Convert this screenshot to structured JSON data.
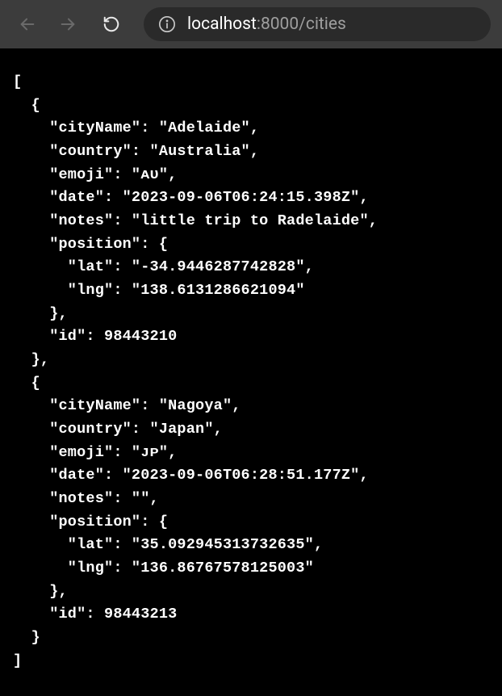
{
  "url": {
    "host": "localhost",
    "port": ":8000",
    "path": "/cities"
  },
  "response": [
    {
      "cityName": "Adelaide",
      "country": "Australia",
      "emoji": "ᴀᴜ",
      "date": "2023-09-06T06:24:15.398Z",
      "notes": "little trip to Radelaide",
      "position": {
        "lat": "-34.9446287742828",
        "lng": "138.6131286621094"
      },
      "id": 98443210
    },
    {
      "cityName": "Nagoya",
      "country": "Japan",
      "emoji": "ᴊᴘ",
      "date": "2023-09-06T06:28:51.177Z",
      "notes": "",
      "position": {
        "lat": "35.092945313732635",
        "lng": "136.86767578125003"
      },
      "id": 98443213
    }
  ]
}
